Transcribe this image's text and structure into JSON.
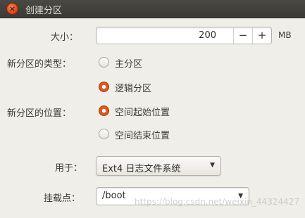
{
  "window": {
    "title": "创建分区",
    "close_icon": "close-icon"
  },
  "size": {
    "label": "大小：",
    "value": "200",
    "decrement": "−",
    "increment": "+",
    "unit": "MB"
  },
  "partition_type": {
    "label": "新分区的类型：",
    "options": [
      {
        "label": "主分区",
        "checked": false
      },
      {
        "label": "逻辑分区",
        "checked": true
      }
    ]
  },
  "partition_position": {
    "label": "新分区的位置：",
    "options": [
      {
        "label": "空间起始位置",
        "checked": true
      },
      {
        "label": "空间结束位置",
        "checked": false
      }
    ]
  },
  "use_as": {
    "label": "用于：",
    "value": "Ext4 日志文件系统"
  },
  "mount_point": {
    "label": "挂载点：",
    "value": "/boot"
  },
  "watermark": "https://blog.csdn.net/weixin_44324427"
}
